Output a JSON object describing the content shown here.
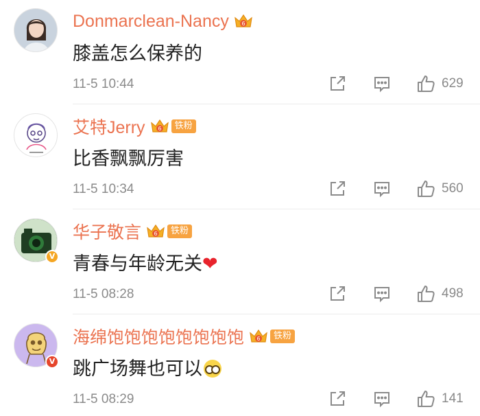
{
  "comments": [
    {
      "username": "Donmarclean-Nancy",
      "text": "膝盖怎么保养的",
      "timestamp": "11-5 10:44",
      "likes": "629",
      "fan_badge": "",
      "verified": ""
    },
    {
      "username": "艾特Jerry",
      "text": "比香飘飘厉害",
      "timestamp": "11-5 10:34",
      "likes": "560",
      "fan_badge": "铁粉",
      "verified": ""
    },
    {
      "username": "华子敬言",
      "text": "青春与年龄无关",
      "timestamp": "11-5 08:28",
      "likes": "498",
      "fan_badge": "铁粉",
      "verified": "gold"
    },
    {
      "username": "海绵饱饱饱饱饱饱饱饱",
      "text": "跳广场舞也可以",
      "timestamp": "11-5 08:29",
      "likes": "141",
      "fan_badge": "铁粉",
      "verified": "red"
    }
  ],
  "icons": {
    "crown": "crown-badge-icon",
    "share": "share-icon",
    "reply": "comment-icon",
    "like": "thumbs-up-icon",
    "heart": "red-heart-emoji",
    "face": "glasses-face-emoji"
  },
  "colors": {
    "username": "#eb7350",
    "text": "#222222",
    "meta": "#8a8a8a",
    "fan_badge": "#f7a341"
  }
}
